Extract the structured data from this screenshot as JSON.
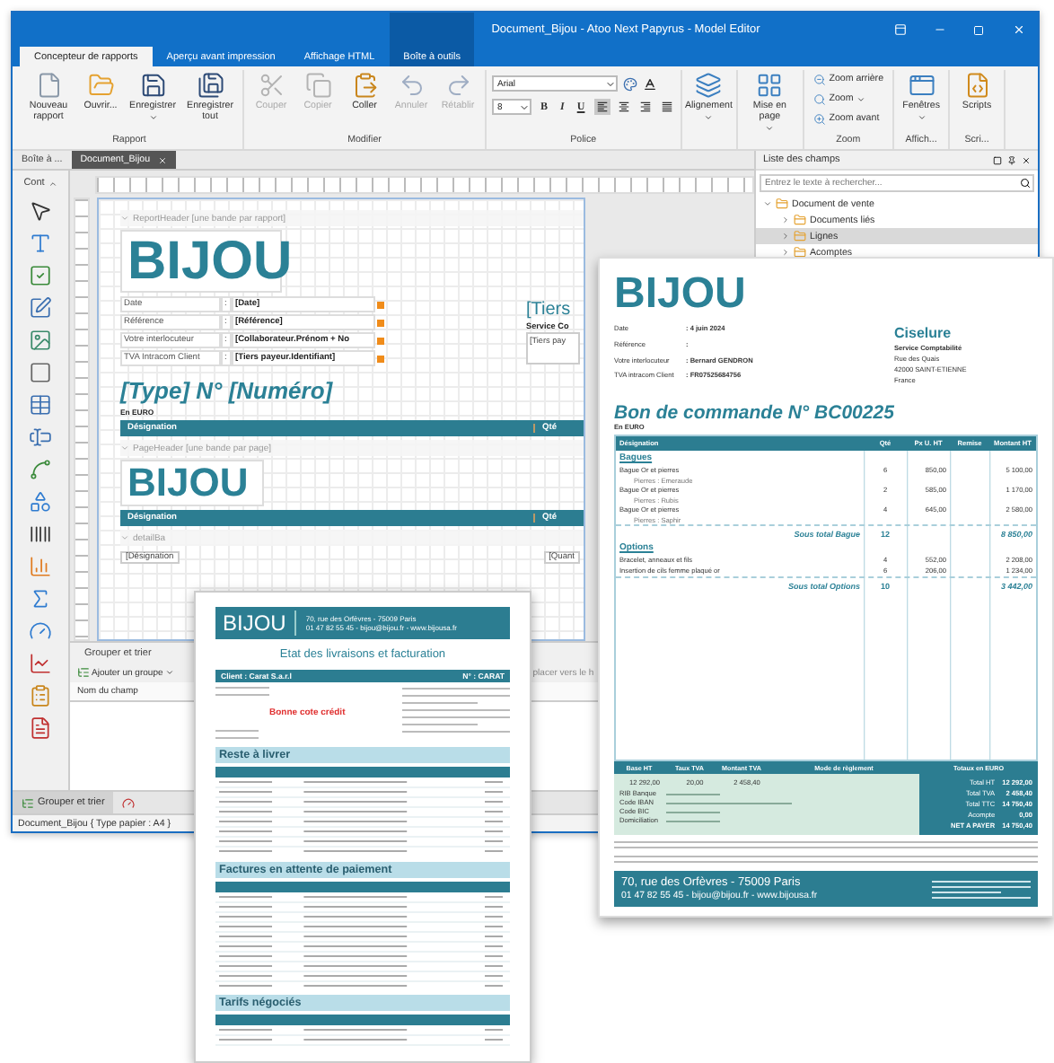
{
  "window": {
    "title": "Document_Bijou - Atoo Next Papyrus - Model Editor"
  },
  "ribbon_tabs": [
    {
      "label": "Concepteur de rapports",
      "selected": true,
      "contextual": false
    },
    {
      "label": "Aperçu avant impression",
      "selected": false,
      "contextual": false
    },
    {
      "label": "Affichage HTML",
      "selected": false,
      "contextual": false
    },
    {
      "label": "Boîte à outils",
      "selected": false,
      "contextual": true
    }
  ],
  "ribbon_groups": [
    {
      "title": "Rapport",
      "kind": "large",
      "buttons": [
        {
          "label": "Nouveau rapport",
          "disabled": false,
          "dropdown": false
        },
        {
          "label": "Ouvrir...",
          "disabled": false,
          "dropdown": false
        },
        {
          "label": "Enregistrer",
          "disabled": false,
          "dropdown": true
        },
        {
          "label": "Enregistrer tout",
          "disabled": false,
          "dropdown": false
        }
      ]
    },
    {
      "title": "Modifier",
      "kind": "large",
      "buttons": [
        {
          "label": "Couper",
          "disabled": true,
          "dropdown": false
        },
        {
          "label": "Copier",
          "disabled": true,
          "dropdown": false
        },
        {
          "label": "Coller",
          "disabled": false,
          "dropdown": false
        },
        {
          "label": "Annuler",
          "disabled": true,
          "dropdown": false
        },
        {
          "label": "Rétablir",
          "disabled": true,
          "dropdown": false
        }
      ]
    },
    {
      "title": "Police",
      "kind": "font",
      "font": "Arial",
      "size": "8",
      "styles": [
        "B",
        "I",
        "U"
      ],
      "align_buttons": [
        {
          "selected": true
        },
        {
          "selected": false
        },
        {
          "selected": false
        },
        {
          "selected": false
        }
      ]
    },
    {
      "kind": "large",
      "buttons": [
        {
          "label": "Alignement",
          "disabled": false,
          "dropdown": true
        }
      ]
    },
    {
      "kind": "large",
      "buttons": [
        {
          "label": "Mise en page",
          "disabled": false,
          "dropdown": true
        }
      ]
    },
    {
      "title": "Zoom",
      "kind": "small",
      "buttons": [
        {
          "label": "Zoom arrière",
          "disabled": false,
          "dropdown": false
        },
        {
          "label": "Zoom",
          "disabled": false,
          "dropdown": true
        },
        {
          "label": "Zoom avant",
          "disabled": false,
          "dropdown": false
        }
      ]
    },
    {
      "title": "Affich...",
      "kind": "large",
      "buttons": [
        {
          "label": "Fenêtres",
          "disabled": false,
          "dropdown": true
        }
      ]
    },
    {
      "title": "Scri...",
      "kind": "large",
      "buttons": [
        {
          "label": "Scripts",
          "disabled": false,
          "dropdown": false
        }
      ]
    }
  ],
  "panel_tabs": [
    {
      "label": "Boîte à ...",
      "selected": false
    },
    {
      "label": "Document_Bijou",
      "selected": true
    }
  ],
  "toolbox": {
    "header": "Cont",
    "expanded": true
  },
  "designer": {
    "report_header": "ReportHeader [une bande par rapport]",
    "logo": "BIJOU",
    "fields": [
      {
        "label": "Date",
        "colon": ":",
        "value": "[Date]"
      },
      {
        "label": "Référence",
        "colon": ":",
        "value": "[Référence]"
      },
      {
        "label": "Votre interlocuteur",
        "colon": ":",
        "value": "[Collaborateur.Prénom + No"
      },
      {
        "label": "TVA Intracom Client",
        "colon": ":",
        "value": "[Tiers payeur.Identifiant]"
      }
    ],
    "tiers_title": "[Tiers",
    "tiers_service": "Service Co",
    "tiers_box": "[Tiers pay",
    "doc_title": "[Type] N° [Numéro]",
    "currency": "En EURO",
    "columns": [
      "Désignation",
      "Qté"
    ],
    "page_header": "PageHeader [une bande par page]",
    "page_logo": "BIJOU",
    "page_columns": [
      "Désignation",
      "Qté"
    ],
    "detail_band": "detailBa",
    "detail_cells": [
      "[Désignation",
      "[Quant"
    ]
  },
  "group_panel": {
    "title": "Grouper et trier",
    "add_group": "Ajouter un groupe",
    "move": "placer vers le h",
    "column": "Nom du champ"
  },
  "bottom_tabs": [
    {
      "label": "Grouper et trier",
      "selected": true
    },
    {
      "selected": false
    }
  ],
  "status_bar": "Document_Bijou { Type papier : A4 }",
  "field_list": {
    "title": "Liste des champs",
    "placeholder": "Entrez le texte à rechercher...",
    "tree": [
      {
        "label": "Document de vente",
        "expanded": true,
        "selected": false,
        "children": [
          {
            "label": "Documents liés",
            "expanded": false,
            "selected": false
          },
          {
            "label": "Lignes",
            "expanded": false,
            "selected": true
          },
          {
            "label": "Acomptes",
            "expanded": false,
            "selected": false
          }
        ]
      }
    ]
  },
  "order_preview": {
    "logo": "BIJOU",
    "info": [
      {
        "label": "Date",
        "value": ": 4 juin 2024"
      },
      {
        "label": "Référence",
        "value": ":"
      },
      {
        "label": "Votre interlocuteur",
        "value": ": Bernard GENDRON"
      },
      {
        "label": "TVA intracom Client",
        "value": ": FR07525684756"
      }
    ],
    "customer": "Ciselure",
    "address": [
      "Service Comptabilité",
      "Rue des Quais",
      "42000 SAINT-ETIENNE",
      "France"
    ],
    "title": "Bon de commande N° BC00225",
    "currency": "En EURO",
    "columns": [
      "Désignation",
      "Qté",
      "Px U. HT",
      "Remise",
      "Montant HT"
    ],
    "groups": [
      {
        "title": "Bagues",
        "items": [
          {
            "name": "Bague Or et pierres",
            "detail": "Pierres : Emeraude",
            "qty": "6",
            "price": "850,00",
            "amount": "5 100,00"
          },
          {
            "name": "Bague Or et pierres",
            "detail": "Pierres : Rubis",
            "qty": "2",
            "price": "585,00",
            "amount": "1 170,00"
          },
          {
            "name": "Bague Or et pierres",
            "detail": "Pierres : Saphir",
            "qty": "4",
            "price": "645,00",
            "amount": "2 580,00"
          }
        ],
        "subtotal_label": "Sous total Bague",
        "subtotal_qty": "12",
        "subtotal_amount": "8 850,00"
      },
      {
        "title": "Options",
        "items": [
          {
            "name": "Bracelet, anneaux et fils",
            "qty": "4",
            "price": "552,00",
            "amount": "2 208,00"
          },
          {
            "name": "Insertion de cils femme plaqué or",
            "qty": "6",
            "price": "206,00",
            "amount": "1 234,00"
          }
        ],
        "subtotal_label": "Sous total Options",
        "subtotal_qty": "10",
        "subtotal_amount": "3 442,00"
      }
    ],
    "vat_columns": [
      "Base HT",
      "Taux TVA",
      "Montant TVA"
    ],
    "payment_label": "Mode de règlement",
    "totals_title": "Totaux en EURO",
    "vat_values": [
      "12 292,00",
      "20,00",
      "2 458,40"
    ],
    "bank_labels": [
      "RIB Banque",
      "Code IBAN",
      "Code BIC",
      "Domiciliation"
    ],
    "totals": [
      {
        "label": "Total HT",
        "value": "12 292,00"
      },
      {
        "label": "Total TVA",
        "value": "2 458,40"
      },
      {
        "label": "Total TTC",
        "value": "14 750,40"
      },
      {
        "label": "Acompte",
        "value": "0,00"
      },
      {
        "label": "NET A PAYER",
        "value": "14 750,40"
      }
    ],
    "footer_address": "70, rue des Orfèvres - 75009 Paris",
    "footer_contact": "01 47 82 55 45 - bijou@bijou.fr - www.bijousa.fr"
  },
  "statement_preview": {
    "logo": "BIJOU",
    "address": "70, rue des Orfèvres - 75009 Paris",
    "contact": "01 47 82 55 45 - bijou@bijou.fr - www.bijousa.fr",
    "title": "Etat des livraisons et facturation",
    "client": "Client : Carat S.a.r.l",
    "number": "N° : CARAT",
    "credit_note": "Bonne cote crédit",
    "sections": [
      "Reste à livrer",
      "Factures en attente de paiement",
      "Tarifs négociés"
    ]
  }
}
